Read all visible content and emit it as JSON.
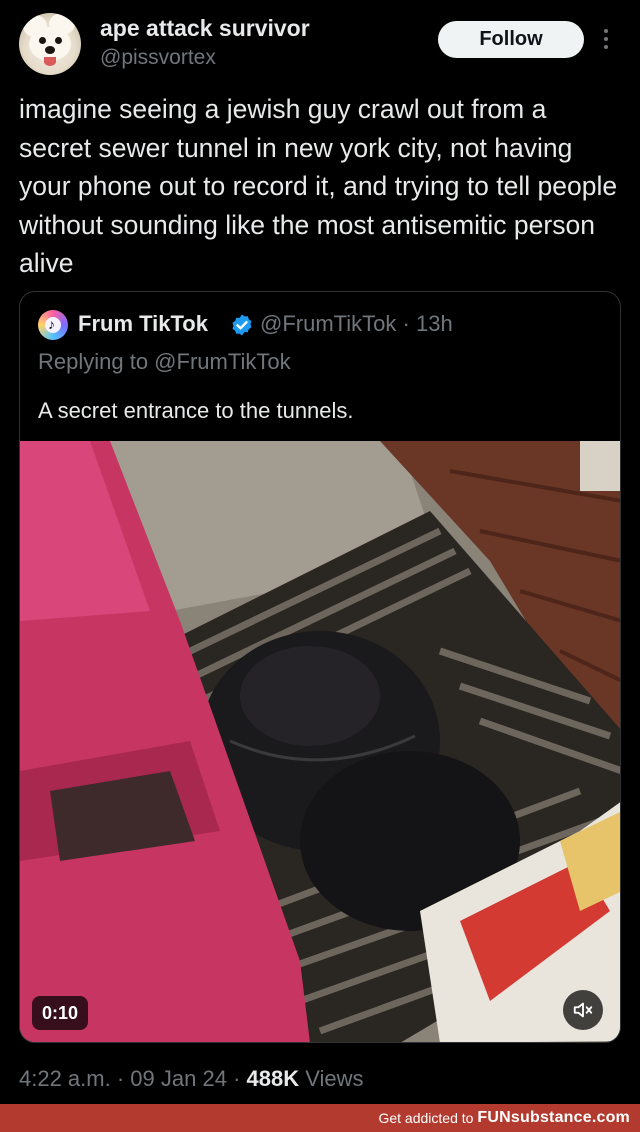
{
  "author": {
    "display_name": "ape attack survivor",
    "handle": "@pissvortex",
    "follow_label": "Follow",
    "more_icon": "more-vertical-icon"
  },
  "tweet": {
    "text": "imagine seeing a jewish guy crawl out from a secret sewer tunnel in new york city, not having your phone out to record it, and trying to tell people without sounding like the most antisemitic person alive"
  },
  "quoted": {
    "display_name": "Frum TikTok",
    "verified": true,
    "verified_icon": "verified-badge-icon",
    "handle": "@FrumTikTok",
    "separator": "·",
    "age": "13h",
    "replying_to": "Replying to @FrumTikTok",
    "text": "A secret entrance to the tunnels.",
    "video": {
      "duration": "0:10",
      "mute_icon": "speaker-muted-icon"
    }
  },
  "meta": {
    "time": "4:22 a.m.",
    "sep1": "·",
    "date": "09 Jan 24",
    "sep2": "·",
    "views_count": "488K",
    "views_label": "Views"
  },
  "watermark": {
    "prefix": "Get addicted to",
    "brand": "FUNsubstance.com"
  },
  "colors": {
    "background": "#000000",
    "text_primary": "#e7e9ea",
    "text_secondary": "#71767b",
    "verified_blue": "#1d9bf0",
    "follow_bg": "#eff3f4",
    "watermark_bar": "#b23a2e"
  }
}
